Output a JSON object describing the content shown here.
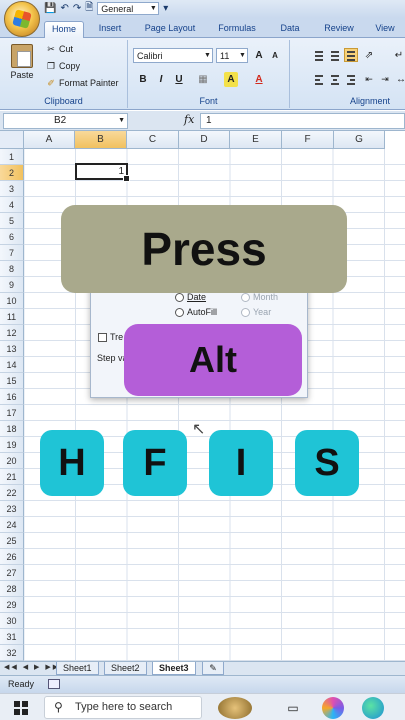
{
  "quick_access": {
    "number_format_value": "General"
  },
  "ribbon": {
    "tabs": [
      "Home",
      "Insert",
      "Page Layout",
      "Formulas",
      "Data",
      "Review",
      "View"
    ],
    "clipboard": {
      "paste_label": "Paste",
      "cut_label": "Cut",
      "copy_label": "Copy",
      "format_painter_label": "Format Painter",
      "group_label": "Clipboard"
    },
    "font": {
      "font_name": "Calibri",
      "font_size": "11",
      "group_label": "Font",
      "grow_label": "A",
      "shrink_label": "A",
      "bold": "B",
      "italic": "I",
      "underline": "U",
      "fill_label": "A",
      "color_label": "A"
    },
    "alignment": {
      "group_label": "Alignment"
    }
  },
  "formula_bar": {
    "name_box": "B2",
    "fx_label": "fx",
    "value": "1"
  },
  "grid": {
    "columns": [
      "A",
      "B",
      "C",
      "D",
      "E",
      "F",
      "G"
    ],
    "selected_column": "B",
    "rows": [
      "1",
      "2",
      "3",
      "4",
      "5",
      "6",
      "7",
      "8",
      "9",
      "10",
      "11",
      "12",
      "13",
      "14",
      "15",
      "16",
      "17",
      "18",
      "19",
      "20",
      "21",
      "22",
      "23",
      "24",
      "25",
      "26",
      "27",
      "28",
      "29",
      "30",
      "31",
      "32"
    ],
    "selected_row": "2",
    "active_cell_value": "1"
  },
  "dialog": {
    "date_label": "Date",
    "autofill_label": "AutoFill",
    "month_label": "Month",
    "year_label": "Year",
    "trend_label": "Tre",
    "step_label": "Step va"
  },
  "overlay": {
    "press_label": "Press",
    "alt_label": "Alt",
    "keys": [
      "H",
      "F",
      "I",
      "S"
    ],
    "press_color": "#a9a98c",
    "alt_color": "#b45ed8",
    "key_color": "#1fc4d6"
  },
  "sheets": [
    "Sheet1",
    "Sheet2",
    "Sheet3"
  ],
  "active_sheet": "Sheet3",
  "status": {
    "text": "Ready"
  },
  "taskbar": {
    "search_placeholder": "Type here to search"
  }
}
